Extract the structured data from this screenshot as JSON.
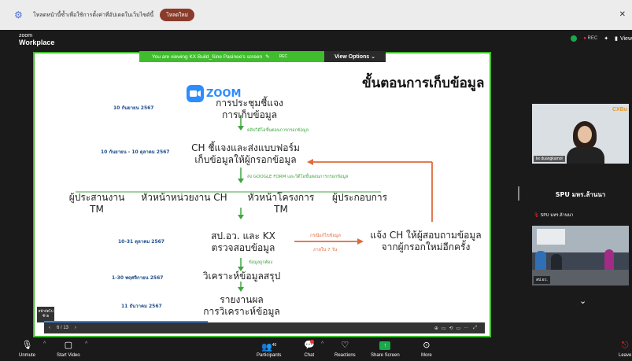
{
  "notification": {
    "text": "โหลดหน้านี้ซ้ำเพื่อใช้การตั้งค่าที่อัปเดตในเว็บไซต์นี้",
    "button": "โหลดใหม่"
  },
  "header": {
    "logo_top": "zoom",
    "logo_bottom": "Workplace",
    "rec": "REC",
    "view": "View"
  },
  "share": {
    "viewing_text": "You are viewing  KX Build_Sine Pasinee's screen",
    "rec": "REC",
    "view_options": "View Options"
  },
  "slide": {
    "title": "ขั้นตอนการเก็บข้อมูล",
    "zoom_word": "ZOOM",
    "step1": "การประชุมชี้แจง\nการเก็บข้อมูล",
    "date1": "10 กันยายน 2567",
    "note1": "คลิปวิดีโอขั้นตอนการกรอกข้อมูล",
    "date2": "10 กันยายน - 10 ตุลาคม 2567",
    "step2": "CH ชี้แจงและส่งแบบฟอร์ม\nเก็บข้อมูลให้ผู้กรอกข้อมูล",
    "note2": "ส่ง GOOGLE FORM และวิดีโอขั้นตอนการกรอกข้อมูล",
    "roles": [
      "ผู้ประสานงาน TM",
      "หัวหน้าหน่วยงาน CH",
      "หัวหน้าโครงการ TM",
      "ผู้ประกอบการ"
    ],
    "date3": "10-31 ตุลาคม 2567",
    "step3": "สป.อว. และ KX\nตรวจสอบข้อมูล",
    "orange1": "กรณีแก้ไขข้อมูล",
    "orange2": "ภายใน 7 วัน",
    "step_side": "แจ้ง CH ให้ผู้สอบถามข้อมูล\nจากผู้กรอกใหม่อีกครั้ง",
    "note3": "ข้อมูลถูกต้อง",
    "date4": "1-30 พฤศจิกายน 2567",
    "step4": "วิเคราะห์ข้อมูลสรุป",
    "date5": "11 ธันวาคม 2567",
    "step5": "รายงานผล\nการวิเคราะห์ข้อมูล"
  },
  "slidebar": {
    "page": "6 / 13",
    "thumb_hint": "หน้าถัดไป ซ้าย"
  },
  "participants": {
    "p1_name": "kx duangkamol",
    "p1_logo": "CXBu",
    "p2_title": "SPU มหร.ล้านนา",
    "p2_label": "SPU มหร.ล้านนา",
    "p3_name": "สป.อว."
  },
  "toolbar": {
    "unmute": "Unmute",
    "start_video": "Start Video",
    "participants": "Participants",
    "participants_count": "40",
    "chat": "Chat",
    "reactions": "Reactions",
    "share_screen": "Share Screen",
    "more": "More",
    "leave": "Leave"
  }
}
